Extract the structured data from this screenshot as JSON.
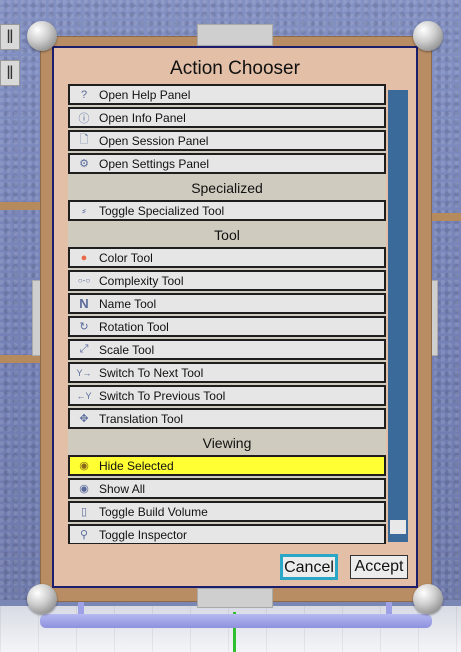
{
  "dialog": {
    "title": "Action Chooser",
    "cancel_label": "Cancel",
    "accept_label": "Accept"
  },
  "list": {
    "items": [
      {
        "label": "Open Help Panel",
        "icon": "help-icon",
        "glyph": "?"
      },
      {
        "label": "Open Info Panel",
        "icon": "info-icon",
        "glyph": "ⓘ"
      },
      {
        "label": "Open Session Panel",
        "icon": "document-icon",
        "glyph": "🗋"
      },
      {
        "label": "Open Settings Panel",
        "icon": "gear-icon",
        "glyph": "⚙"
      },
      {
        "label": "Toggle Specialized Tool",
        "icon": "specialized-tool-icon",
        "glyph": "⸗"
      },
      {
        "label": "Color Tool",
        "icon": "color-wheel-icon",
        "glyph": "●"
      },
      {
        "label": "Complexity Tool",
        "icon": "complexity-icon",
        "glyph": "○-○"
      },
      {
        "label": "Name Tool",
        "icon": "name-n-icon",
        "glyph": "N"
      },
      {
        "label": "Rotation Tool",
        "icon": "rotation-icon",
        "glyph": "↻"
      },
      {
        "label": "Scale Tool",
        "icon": "scale-icon",
        "glyph": "⤢"
      },
      {
        "label": "Switch To Next Tool",
        "icon": "next-tool-icon",
        "glyph": "Y→"
      },
      {
        "label": "Switch To Previous Tool",
        "icon": "previous-tool-icon",
        "glyph": "←Y"
      },
      {
        "label": "Translation Tool",
        "icon": "translation-icon",
        "glyph": "✥"
      },
      {
        "label": "Hide Selected",
        "icon": "hide-eye-icon",
        "glyph": "◉"
      },
      {
        "label": "Show All",
        "icon": "eye-icon",
        "glyph": "◉"
      },
      {
        "label": "Toggle Build Volume",
        "icon": "build-volume-icon",
        "glyph": "▯"
      },
      {
        "label": "Toggle Inspector",
        "icon": "magnifier-icon",
        "glyph": "⚲"
      }
    ],
    "headers": [
      "Specialized",
      "Tool",
      "Viewing"
    ],
    "selected": "Hide Selected"
  },
  "colors": {
    "panel": "#e2bfa6",
    "border": "#1d1d6e",
    "selected_item": "#ffff33",
    "scrollbar": "#3a6a9a",
    "cancel_focus": "#2aa7c6"
  },
  "scrollbar": {
    "position": "bottom"
  }
}
